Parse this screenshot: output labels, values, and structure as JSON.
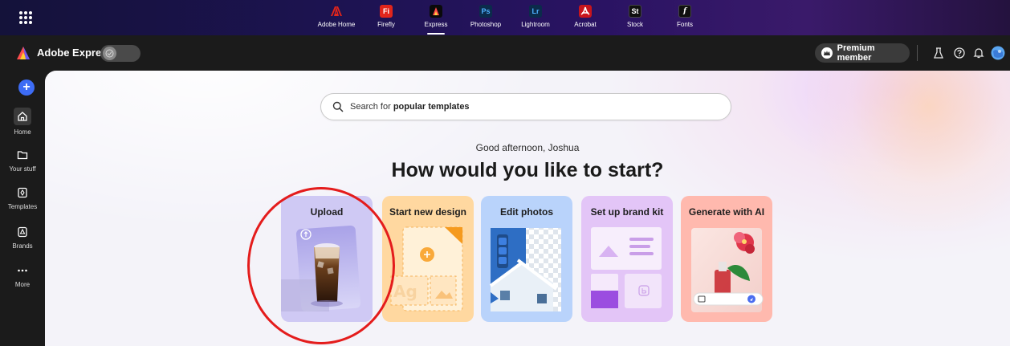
{
  "app_switcher": {
    "apps": [
      {
        "name": "adobe-home",
        "label": "Adobe Home",
        "tile": "A",
        "color": "#e1251b"
      },
      {
        "name": "firefly",
        "label": "Firefly",
        "tile": "Fi",
        "color": "#e1251b"
      },
      {
        "name": "express",
        "label": "Express",
        "tile": "A",
        "color": "#101010",
        "active": true
      },
      {
        "name": "photoshop",
        "label": "Photoshop",
        "tile": "Ps",
        "color": "#0b2b4b"
      },
      {
        "name": "lightroom",
        "label": "Lightroom",
        "tile": "Lr",
        "color": "#0b2b4b"
      },
      {
        "name": "acrobat",
        "label": "Acrobat",
        "tile": "A",
        "color": "#c8151c"
      },
      {
        "name": "stock",
        "label": "Stock",
        "tile": "St",
        "color": "#101010"
      },
      {
        "name": "fonts",
        "label": "Fonts",
        "tile": "f",
        "color": "#101010"
      }
    ]
  },
  "header": {
    "app_name": "Adobe Express",
    "premium_label": "Premium member"
  },
  "sidebar": {
    "create_icon": "plus-icon",
    "items": [
      {
        "label": "Home",
        "icon": "home-icon"
      },
      {
        "label": "Your stuff",
        "icon": "folder-icon"
      },
      {
        "label": "Templates",
        "icon": "templates-icon"
      },
      {
        "label": "Brands",
        "icon": "brands-icon"
      },
      {
        "label": "More",
        "icon": "more-icon"
      }
    ]
  },
  "main": {
    "search_placeholder_prefix": "Search for ",
    "search_placeholder_bold": "popular templates",
    "greeting": "Good afternoon, Joshua",
    "headline": "How would you like to start?",
    "cards": [
      {
        "title": "Upload"
      },
      {
        "title": "Start new design"
      },
      {
        "title": "Edit photos"
      },
      {
        "title": "Set up brand kit"
      },
      {
        "title": "Generate with AI"
      }
    ],
    "ai_card_glyph": "Ag"
  },
  "colors": {
    "accent_blue": "#3d6cf5",
    "annotation_red": "#e41c1c",
    "upload_card": "#cfc9f4",
    "design_card": "#ffd8a0",
    "photos_card": "#b9d3fb",
    "brand_card": "#e3c5f7",
    "ai_card": "#ffb9ae"
  }
}
